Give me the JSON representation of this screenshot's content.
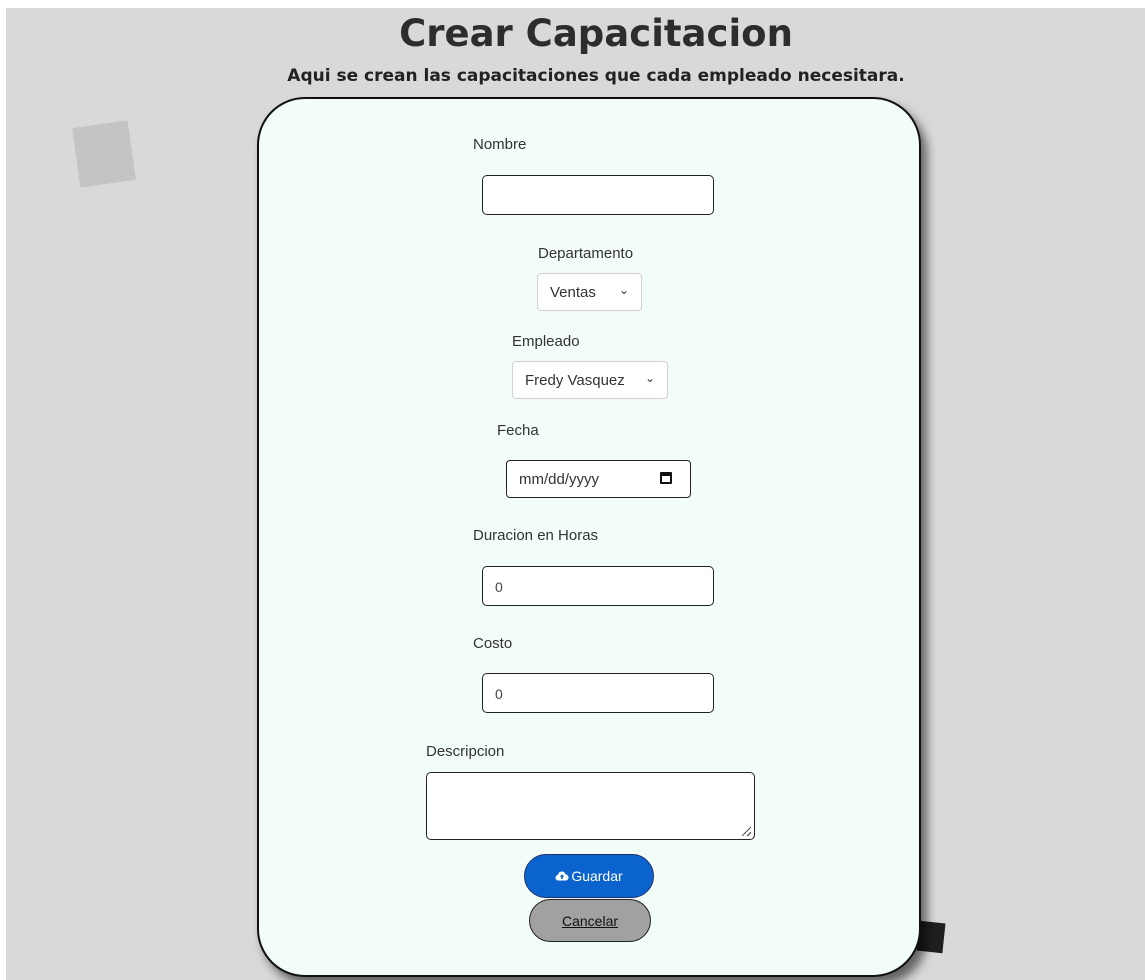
{
  "header": {
    "title": "Crear Capacitacion",
    "subtitle": "Aqui se crean las capacitaciones que cada empleado necesitara."
  },
  "form": {
    "nombre": {
      "label": "Nombre",
      "value": ""
    },
    "departamento": {
      "label": "Departamento",
      "selected": "Ventas"
    },
    "empleado": {
      "label": "Empleado",
      "selected": "Fredy Vasquez"
    },
    "fecha": {
      "label": "Fecha",
      "placeholder": "mm/dd/yyyy"
    },
    "duracion": {
      "label": "Duracion en Horas",
      "value": "0"
    },
    "costo": {
      "label": "Costo",
      "value": "0"
    },
    "descripcion": {
      "label": "Descripcion",
      "value": ""
    }
  },
  "buttons": {
    "save_label": "Guardar",
    "save_icon": "cloud-upload-icon",
    "cancel_label": "Cancelar"
  },
  "colors": {
    "page_bg": "#d9d9d9",
    "card_bg": "#f3fdf8",
    "save_button": "#0b63ce",
    "cancel_button": "#a1a1a1"
  }
}
